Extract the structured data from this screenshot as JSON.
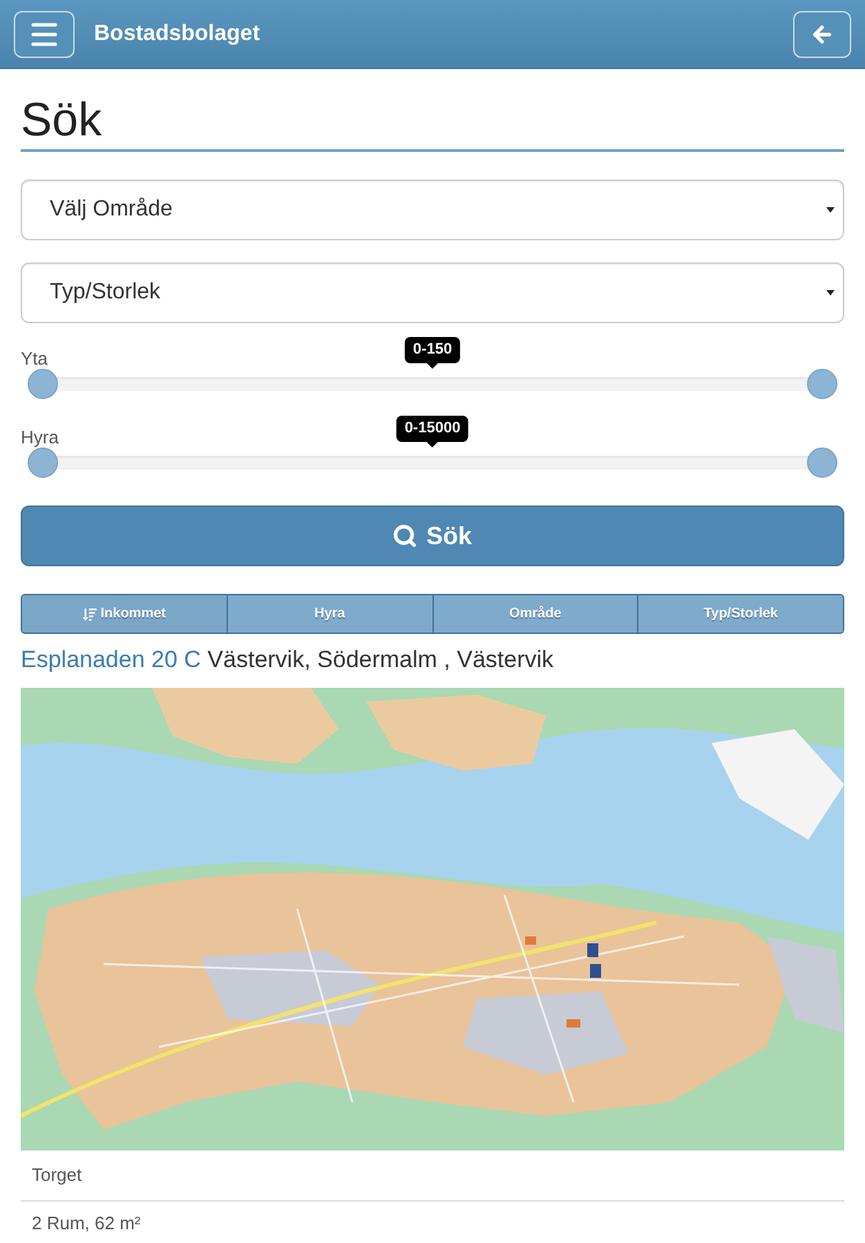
{
  "header": {
    "title": "Bostadsbolaget"
  },
  "page_title": "Sök",
  "selects": [
    {
      "value": "Välj Område"
    },
    {
      "value": "Typ/Storlek"
    }
  ],
  "sliders": [
    {
      "label": "Yta",
      "reading": "0-150",
      "thumbs": [
        {
          "level": 0
        },
        {
          "level": 1
        }
      ]
    },
    {
      "label": "Hyra",
      "reading": "0-15000",
      "thumbs": [
        {
          "level": 0
        },
        {
          "level": 1
        }
      ]
    }
  ],
  "search_button": {
    "label": "Sök"
  },
  "sort_tabs": [
    {
      "label": "Inkommet",
      "selected": true
    },
    {
      "label": "Hyra",
      "selected": false
    },
    {
      "label": "Område",
      "selected": false
    },
    {
      "label": "Typ/Storlek",
      "selected": false
    }
  ],
  "result": {
    "address": "Esplanaden 20 C",
    "location": "Västervik, Södermalm , Västervik",
    "details": [
      "Torget",
      "2 Rum, 62 m²"
    ]
  }
}
